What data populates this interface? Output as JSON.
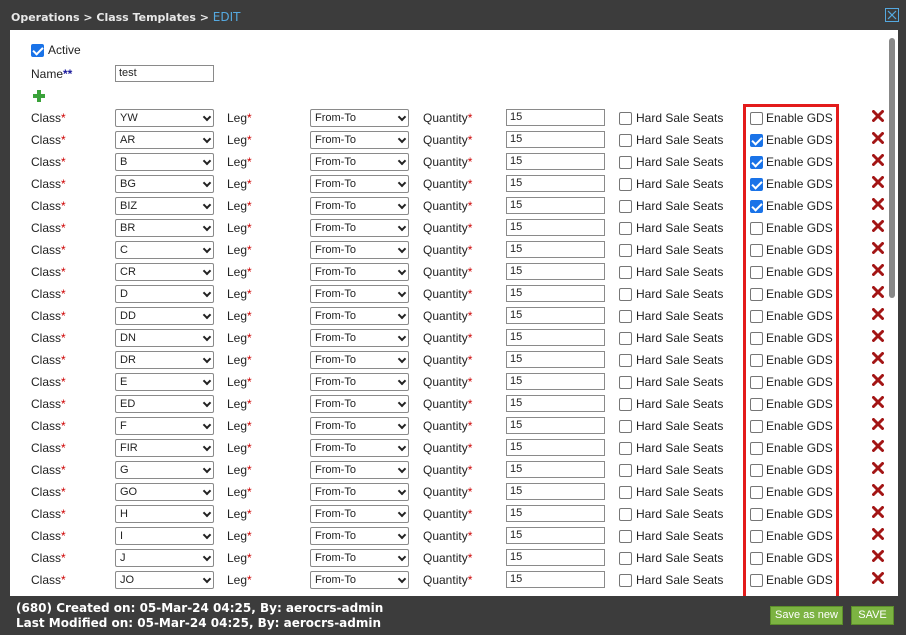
{
  "header": {
    "breadcrumb_path": "Operations > Class Templates > ",
    "breadcrumb_current": "EDIT",
    "close_icon": "close-icon"
  },
  "form": {
    "active_label": "Active",
    "active_checked": true,
    "name_label": "Name",
    "name_required": "**",
    "name_value": "test",
    "add_icon": "plus-icon"
  },
  "labels": {
    "class": "Class",
    "leg": "Leg",
    "quantity": "Quantity",
    "required_mark": "*",
    "hard_sale": "Hard Sale Seats",
    "enable_gds": "Enable GDS"
  },
  "rows": [
    {
      "class": "YW",
      "leg": "From-To",
      "quantity": "15",
      "hard_sale": false,
      "gds": false
    },
    {
      "class": "AR",
      "leg": "From-To",
      "quantity": "15",
      "hard_sale": false,
      "gds": true
    },
    {
      "class": "B",
      "leg": "From-To",
      "quantity": "15",
      "hard_sale": false,
      "gds": true
    },
    {
      "class": "BG",
      "leg": "From-To",
      "quantity": "15",
      "hard_sale": false,
      "gds": true
    },
    {
      "class": "BIZ",
      "leg": "From-To",
      "quantity": "15",
      "hard_sale": false,
      "gds": true
    },
    {
      "class": "BR",
      "leg": "From-To",
      "quantity": "15",
      "hard_sale": false,
      "gds": false
    },
    {
      "class": "C",
      "leg": "From-To",
      "quantity": "15",
      "hard_sale": false,
      "gds": false
    },
    {
      "class": "CR",
      "leg": "From-To",
      "quantity": "15",
      "hard_sale": false,
      "gds": false
    },
    {
      "class": "D",
      "leg": "From-To",
      "quantity": "15",
      "hard_sale": false,
      "gds": false
    },
    {
      "class": "DD",
      "leg": "From-To",
      "quantity": "15",
      "hard_sale": false,
      "gds": false
    },
    {
      "class": "DN",
      "leg": "From-To",
      "quantity": "15",
      "hard_sale": false,
      "gds": false
    },
    {
      "class": "DR",
      "leg": "From-To",
      "quantity": "15",
      "hard_sale": false,
      "gds": false
    },
    {
      "class": "E",
      "leg": "From-To",
      "quantity": "15",
      "hard_sale": false,
      "gds": false
    },
    {
      "class": "ED",
      "leg": "From-To",
      "quantity": "15",
      "hard_sale": false,
      "gds": false
    },
    {
      "class": "F",
      "leg": "From-To",
      "quantity": "15",
      "hard_sale": false,
      "gds": false
    },
    {
      "class": "FIR",
      "leg": "From-To",
      "quantity": "15",
      "hard_sale": false,
      "gds": false
    },
    {
      "class": "G",
      "leg": "From-To",
      "quantity": "15",
      "hard_sale": false,
      "gds": false
    },
    {
      "class": "GO",
      "leg": "From-To",
      "quantity": "15",
      "hard_sale": false,
      "gds": false
    },
    {
      "class": "H",
      "leg": "From-To",
      "quantity": "15",
      "hard_sale": false,
      "gds": false
    },
    {
      "class": "I",
      "leg": "From-To",
      "quantity": "15",
      "hard_sale": false,
      "gds": false
    },
    {
      "class": "J",
      "leg": "From-To",
      "quantity": "15",
      "hard_sale": false,
      "gds": false
    },
    {
      "class": "JO",
      "leg": "From-To",
      "quantity": "15",
      "hard_sale": false,
      "gds": false
    }
  ],
  "footer": {
    "created": "(680) Created on: 05-Mar-24 04:25, By: aerocrs-admin",
    "modified": "Last Modified on: 05-Mar-24 04:25, By: aerocrs-admin",
    "save_as_new_label": "Save as new",
    "save_label": "SAVE"
  },
  "colors": {
    "required": "#cc0000",
    "delete_icon": "#a31515",
    "button_green": "#7cb342",
    "highlight_border": "#e31b1b",
    "breadcrumb_current": "#55a9e0"
  }
}
